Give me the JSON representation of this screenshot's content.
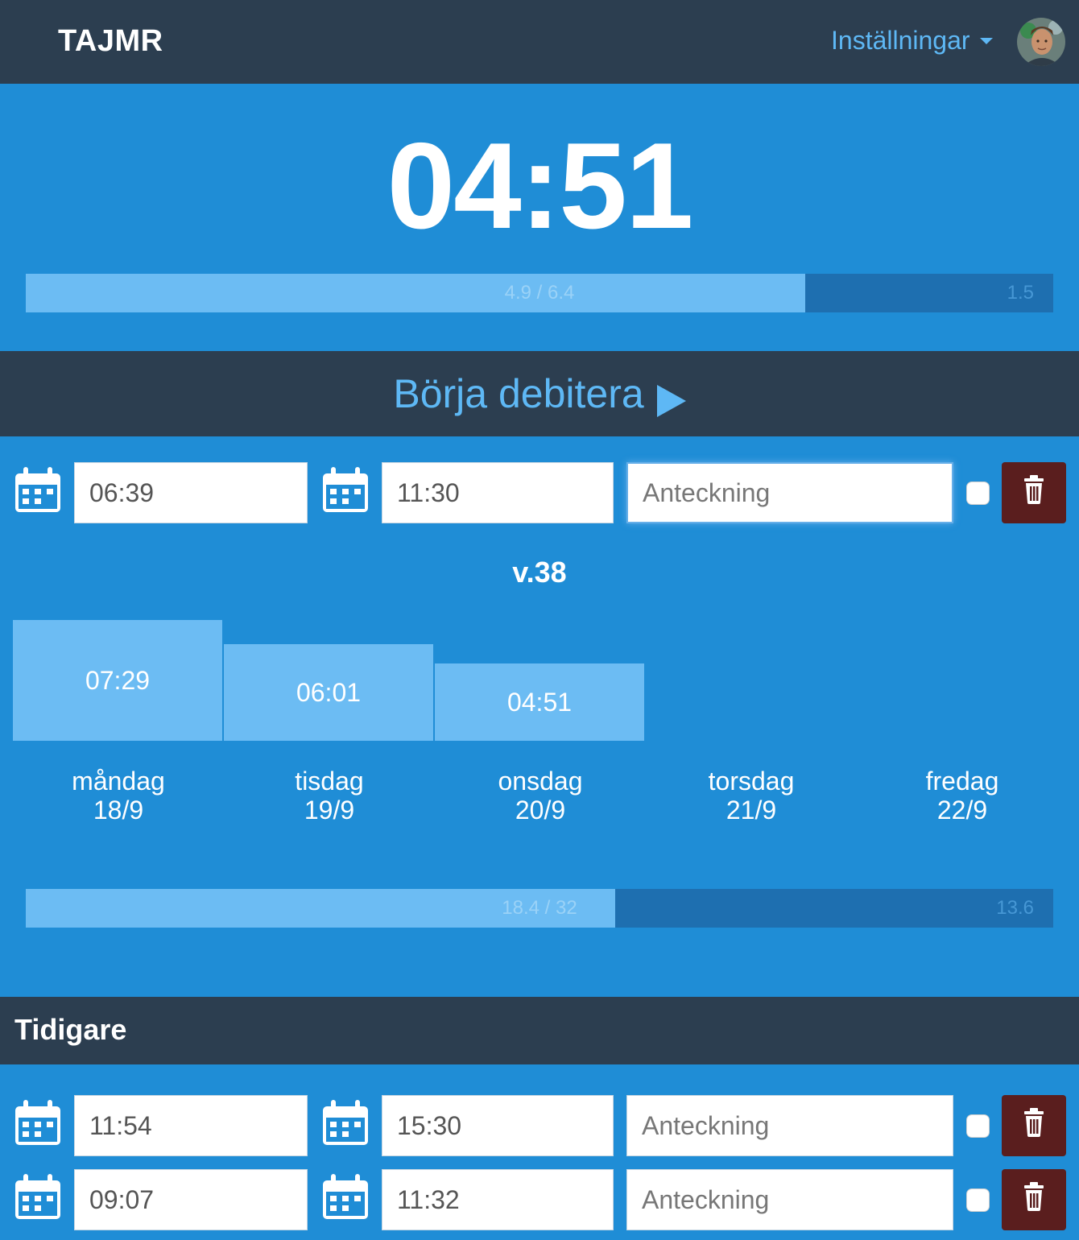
{
  "navbar": {
    "brand": "TAJMR",
    "settings_label": "Inställningar"
  },
  "timer": {
    "value": "04:51"
  },
  "day_progress": {
    "fraction": 0.759,
    "center_label": "4.9 / 6.4",
    "right_label": "1.5"
  },
  "start_button": {
    "label": "Börja debitera"
  },
  "current_entry": {
    "start": "06:39",
    "end": "11:30",
    "note_placeholder": "Anteckning"
  },
  "week": {
    "label": "v.38",
    "days": [
      {
        "name": "måndag",
        "date": "18/9",
        "hours": "07:29"
      },
      {
        "name": "tisdag",
        "date": "19/9",
        "hours": "06:01"
      },
      {
        "name": "onsdag",
        "date": "20/9",
        "hours": "04:51"
      },
      {
        "name": "torsdag",
        "date": "21/9",
        "hours": ""
      },
      {
        "name": "fredag",
        "date": "22/9",
        "hours": ""
      }
    ]
  },
  "week_progress": {
    "fraction": 0.574,
    "center_label": "18.4 / 32",
    "right_label": "13.6"
  },
  "earlier": {
    "title": "Tidigare",
    "entries": [
      {
        "start": "11:54",
        "end": "15:30",
        "note_placeholder": "Anteckning"
      },
      {
        "start": "09:07",
        "end": "11:32",
        "note_placeholder": "Anteckning"
      }
    ]
  },
  "colors": {
    "background": "#1f8dd6",
    "navbar": "#2c3e50",
    "accent": "#5eb8f5",
    "bar": "#6cbcf3",
    "danger": "#5a1e1e"
  },
  "icons": {
    "calendar": "calendar-icon",
    "trash": "trash-icon",
    "play": "play-icon",
    "caret": "caret-down-icon"
  }
}
